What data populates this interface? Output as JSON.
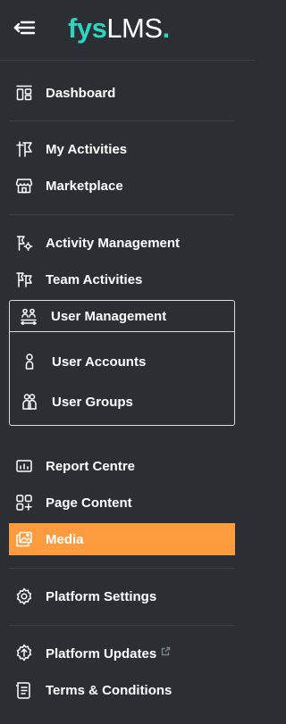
{
  "brand": {
    "part1": "fys",
    "part2": "LMS",
    "dot": "."
  },
  "colors": {
    "background": "#2b2f33",
    "accent": "#fd9b3f",
    "brand": "#2fd3c0"
  },
  "nav": {
    "dashboard": {
      "label": "Dashboard",
      "icon": "dashboard-icon"
    },
    "my_activities": {
      "label": "My Activities",
      "icon": "flag-icon"
    },
    "marketplace": {
      "label": "Marketplace",
      "icon": "store-icon"
    },
    "activity_management": {
      "label": "Activity Management",
      "icon": "flag-gear-icon"
    },
    "team_activities": {
      "label": "Team Activities",
      "icon": "flags-icon"
    },
    "user_management": {
      "label": "User Management",
      "icon": "users-icon",
      "expanded": true,
      "children": {
        "user_accounts": {
          "label": "User Accounts",
          "icon": "user-icon"
        },
        "user_groups": {
          "label": "User Groups",
          "icon": "user-group-icon"
        }
      }
    },
    "report_centre": {
      "label": "Report Centre",
      "icon": "report-icon"
    },
    "page_content": {
      "label": "Page Content",
      "icon": "grid-plus-icon"
    },
    "media": {
      "label": "Media",
      "icon": "images-icon",
      "active": true
    },
    "platform_settings": {
      "label": "Platform Settings",
      "icon": "gear-icon"
    },
    "platform_updates": {
      "label": "Platform Updates",
      "icon": "update-icon",
      "external": true
    },
    "terms": {
      "label": "Terms & Conditions",
      "icon": "document-icon"
    }
  }
}
